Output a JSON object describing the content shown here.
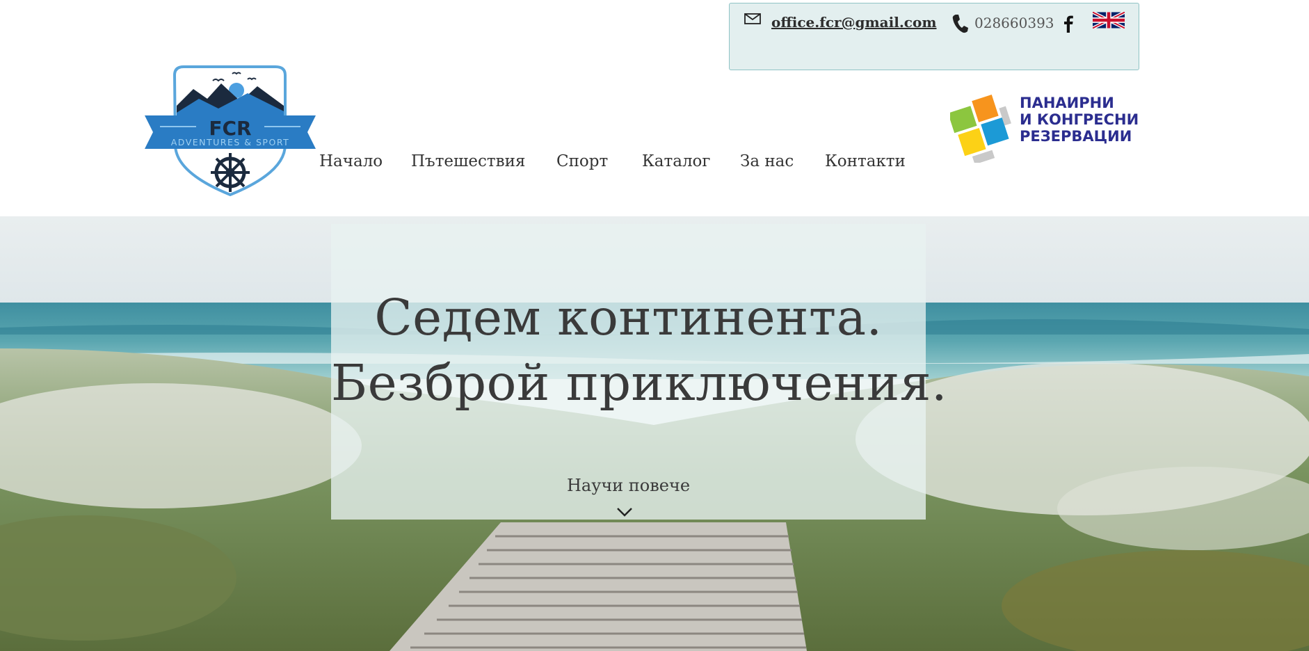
{
  "contact": {
    "email": "office.fcr@gmail.com",
    "phone": "028660393",
    "icons": [
      "mail-icon",
      "phone-icon",
      "facebook-icon",
      "uk-flag-icon"
    ]
  },
  "logo": {
    "name": "FCR",
    "tagline": "ADVENTURES & SPORT"
  },
  "nav": {
    "items": [
      {
        "label": "Начало"
      },
      {
        "label": "Пътешествия"
      },
      {
        "label": "Спорт"
      },
      {
        "label": "Каталог"
      },
      {
        "label": "За нас"
      },
      {
        "label": "Контакти"
      }
    ]
  },
  "partner": {
    "lines": [
      "ПАНАИРНИ",
      "И КОНГРЕСНИ",
      "РЕЗЕРВАЦИИ"
    ]
  },
  "hero": {
    "title_line1": "Седем континента.",
    "title_line2": "Безброй приключения.",
    "cta": "Научи повече"
  },
  "colors": {
    "topbar_bg": "#e3efef",
    "topbar_border": "#8fc3c5",
    "text": "#3a3a3a",
    "partner_text": "#2b2d8f",
    "logo_blue": "#2a7cc4",
    "logo_dark": "#1b2a3e"
  }
}
